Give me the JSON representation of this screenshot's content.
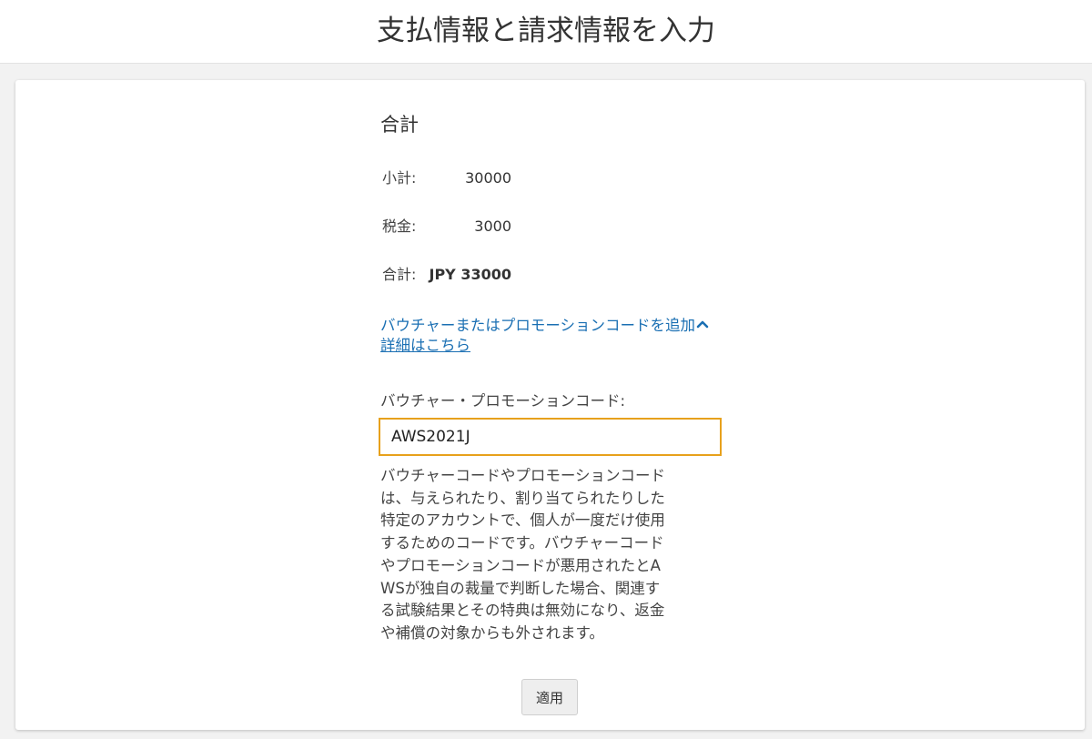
{
  "header": {
    "title": "支払情報と請求情報を入力"
  },
  "summary": {
    "heading": "合計",
    "rows": [
      {
        "label": "小計:",
        "value": "30000"
      },
      {
        "label": "税金:",
        "value": "3000"
      },
      {
        "label": "合計:",
        "value": "JPY 33000"
      }
    ]
  },
  "promo": {
    "toggle_label": "バウチャーまたはプロモーションコードを追加",
    "toggle_icon": "chevron-up-icon",
    "details_link": "詳細はこちら",
    "field_label": "バウチャー・プロモーションコード:",
    "input_value": "AWS2021J",
    "description": "バウチャーコードやプロモーションコードは、与えられたり、割り当てられたりした特定のアカウントで、個人が一度だけ使用するためのコードです。バウチャーコードやプロモーションコードが悪用されたとAWSが独自の裁量で判断した場合、関連する試験結果とその特典は無効になり、返金や補償の対象からも外されます。",
    "apply_button": "適用"
  },
  "colors": {
    "link": "#1a6fb3",
    "input_focus_border": "#e7a11c",
    "page_background": "#f2f2f2"
  }
}
